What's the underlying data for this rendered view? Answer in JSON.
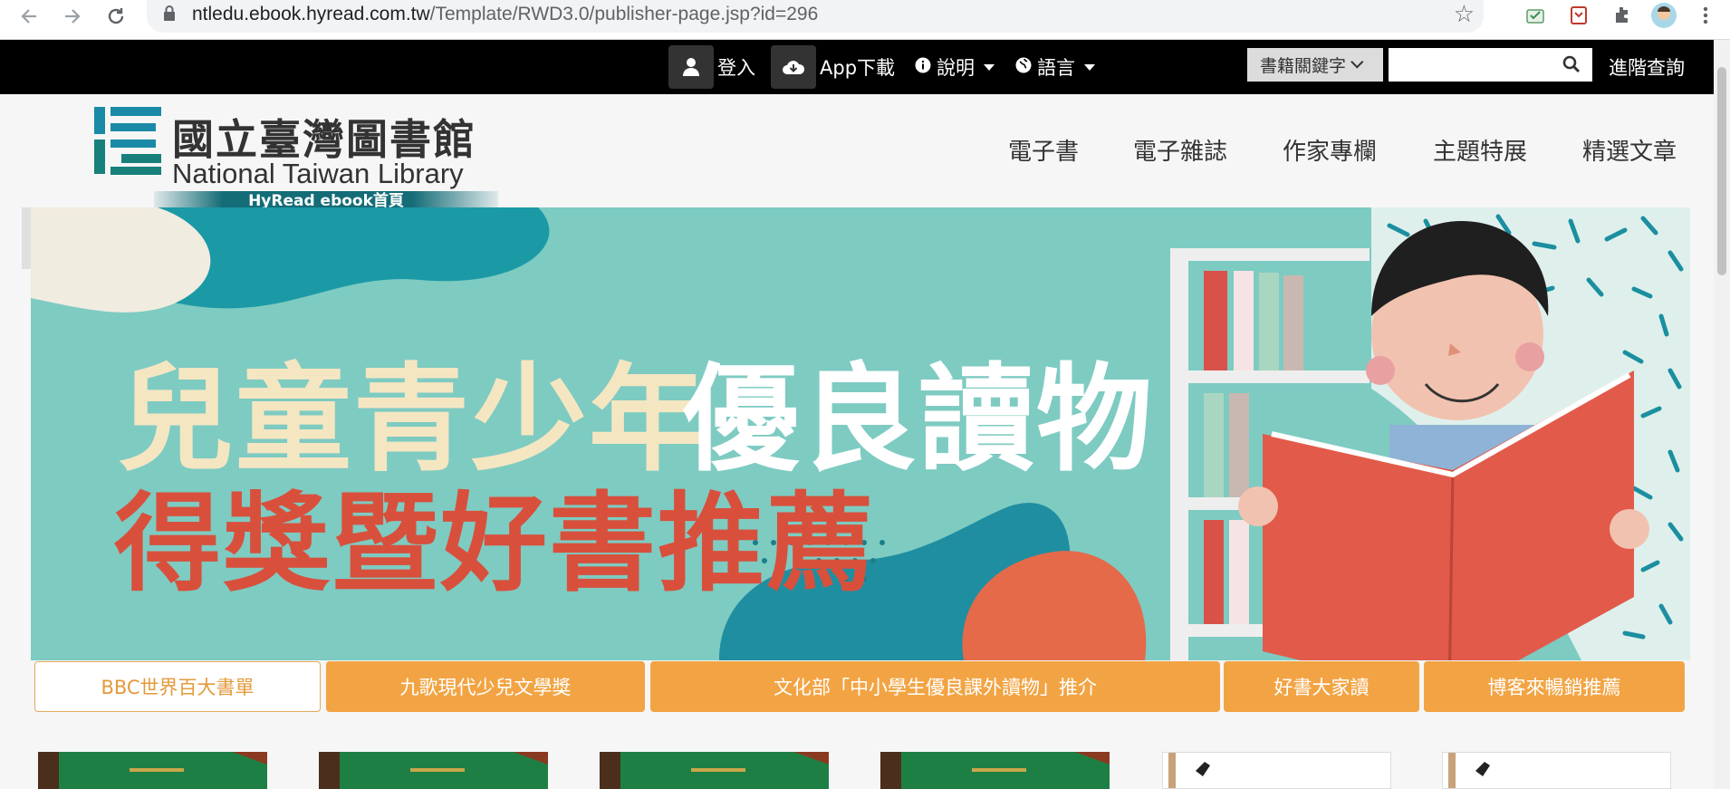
{
  "browser": {
    "url_host": "ntledu.ebook.hyread.com.tw",
    "url_path": "/Template/RWD3.0/publisher-page.jsp?id=296",
    "icons": [
      "back-arrow-icon",
      "forward-arrow-icon",
      "reload-icon",
      "lock-icon",
      "bookmark-star-icon",
      "extension-icon",
      "puzzle-icon",
      "profile-avatar-icon",
      "kebab-menu-icon"
    ]
  },
  "topbar": {
    "login": "登入",
    "app_download": "App下載",
    "help": "說明",
    "language": "語言",
    "search_scope": "書籍關鍵字",
    "search_placeholder": "",
    "advanced_search": "進階查詢"
  },
  "logo": {
    "name_cn": "國立臺灣圖書館",
    "name_en": "National Taiwan Library",
    "home_link": "HyRead ebook首頁"
  },
  "main_nav": [
    "電子書",
    "電子雜誌",
    "作家專欄",
    "主題特展",
    "精選文章"
  ],
  "banner": {
    "title_part1": "兒童青少年",
    "title_part2": "優良讀物",
    "subtitle": "得獎暨好書推薦"
  },
  "tabs": [
    {
      "label": "BBC世界百大書單",
      "active": true
    },
    {
      "label": "九歌現代少兒文學獎",
      "active": false
    },
    {
      "label": "文化部「中小學生優良課外讀物」推介",
      "active": false
    },
    {
      "label": "好書大家讀",
      "active": false
    },
    {
      "label": "博客來暢銷推薦",
      "active": false
    }
  ],
  "colors": {
    "topbar_bg": "#000000",
    "banner_bg": "#7ecbc2",
    "tab_orange": "#f2a444",
    "title_cream": "#f5e6c2",
    "title_red": "#d8503c"
  }
}
